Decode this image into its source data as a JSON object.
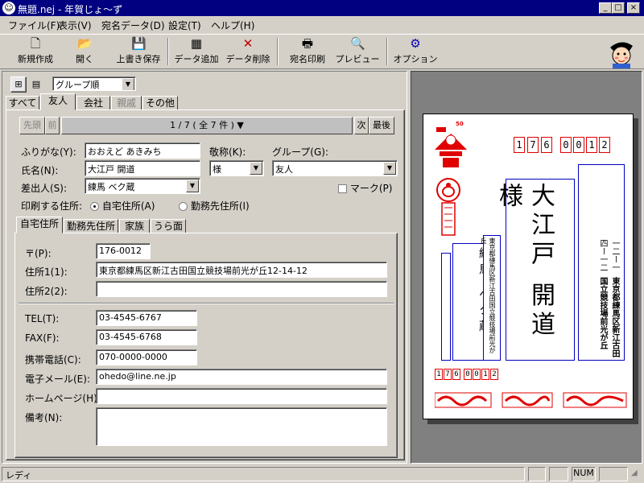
{
  "window": {
    "title": "無題.nej - 年賀じょ〜ず"
  },
  "menu": [
    "ファイル(F)",
    "表示(V)",
    "宛名データ(D)",
    "設定(T)",
    "ヘルプ(H)"
  ],
  "toolbar": {
    "new": "新規作成",
    "open": "開く",
    "save": "上書き保存",
    "add": "データ追加",
    "delete": "データ削除",
    "print": "宛名印刷",
    "preview": "プレビュー",
    "options": "オプション"
  },
  "view": {
    "sort": "グループ順"
  },
  "group_tabs": [
    "すべて",
    "友人",
    "会社",
    "親戚",
    "その他"
  ],
  "nav": {
    "first": "先頭",
    "prev": "前",
    "record": "1 / 7 ( 全 7 件 ) ▼",
    "next": "次",
    "last": "最後"
  },
  "form": {
    "furigana_label": "ふりがな(Y):",
    "furigana": "おおえど あきみち",
    "honorific_label": "敬称(K):",
    "honorific": "様",
    "group_label": "グループ(G):",
    "group": "友人",
    "name_label": "氏名(N):",
    "name": "大江戸 開道",
    "sender_label": "差出人(S):",
    "sender": "練馬 ベク蔵",
    "mark_label": "マーク(P)",
    "address_choice_label": "印刷する住所:",
    "home_radio": "自宅住所(A)",
    "work_radio": "勤務先住所(I)"
  },
  "address_tabs": [
    "自宅住所",
    "勤務先住所",
    "家族",
    "うら面"
  ],
  "address": {
    "zip_label": "〒(P):",
    "zip": "176-0012",
    "addr1_label": "住所1(1):",
    "addr1": "東京都練馬区新江古田国立競技場前光が丘12-14-12",
    "addr2_label": "住所2(2):",
    "addr2": "",
    "tel_label": "TEL(T):",
    "tel": "03-4545-6767",
    "fax_label": "FAX(F):",
    "fax": "03-4545-6768",
    "mobile_label": "携帯電話(C):",
    "mobile": "070-0000-0000",
    "email_label": "電子メール(E):",
    "email": "ohedo@line.ne.jp",
    "homepage_label": "ホームページ(H):",
    "homepage": "",
    "notes_label": "備考(N):",
    "notes": ""
  },
  "postcard": {
    "zip_digits": [
      "1",
      "7",
      "6",
      "0",
      "0",
      "1",
      "2"
    ],
    "stamp_value": "50",
    "recipient_name": "大江戸 開道 様",
    "recipient_address": "東京都練馬区新江古田国立競技場前光が丘",
    "recipient_number": "一二ー一四ー一二",
    "sender_name": "練馬 ベク蔵",
    "sender_address": "東京都練馬区新江古田国立競技場前光が丘",
    "sender_zip": [
      "1",
      "7",
      "6",
      "0",
      "0",
      "1",
      "2"
    ]
  },
  "status": {
    "text": "レディ",
    "num": "NUM"
  },
  "colors": {
    "titlebar": "#000080",
    "postal_red": "#e00000",
    "frame_blue": "#0000c0"
  }
}
